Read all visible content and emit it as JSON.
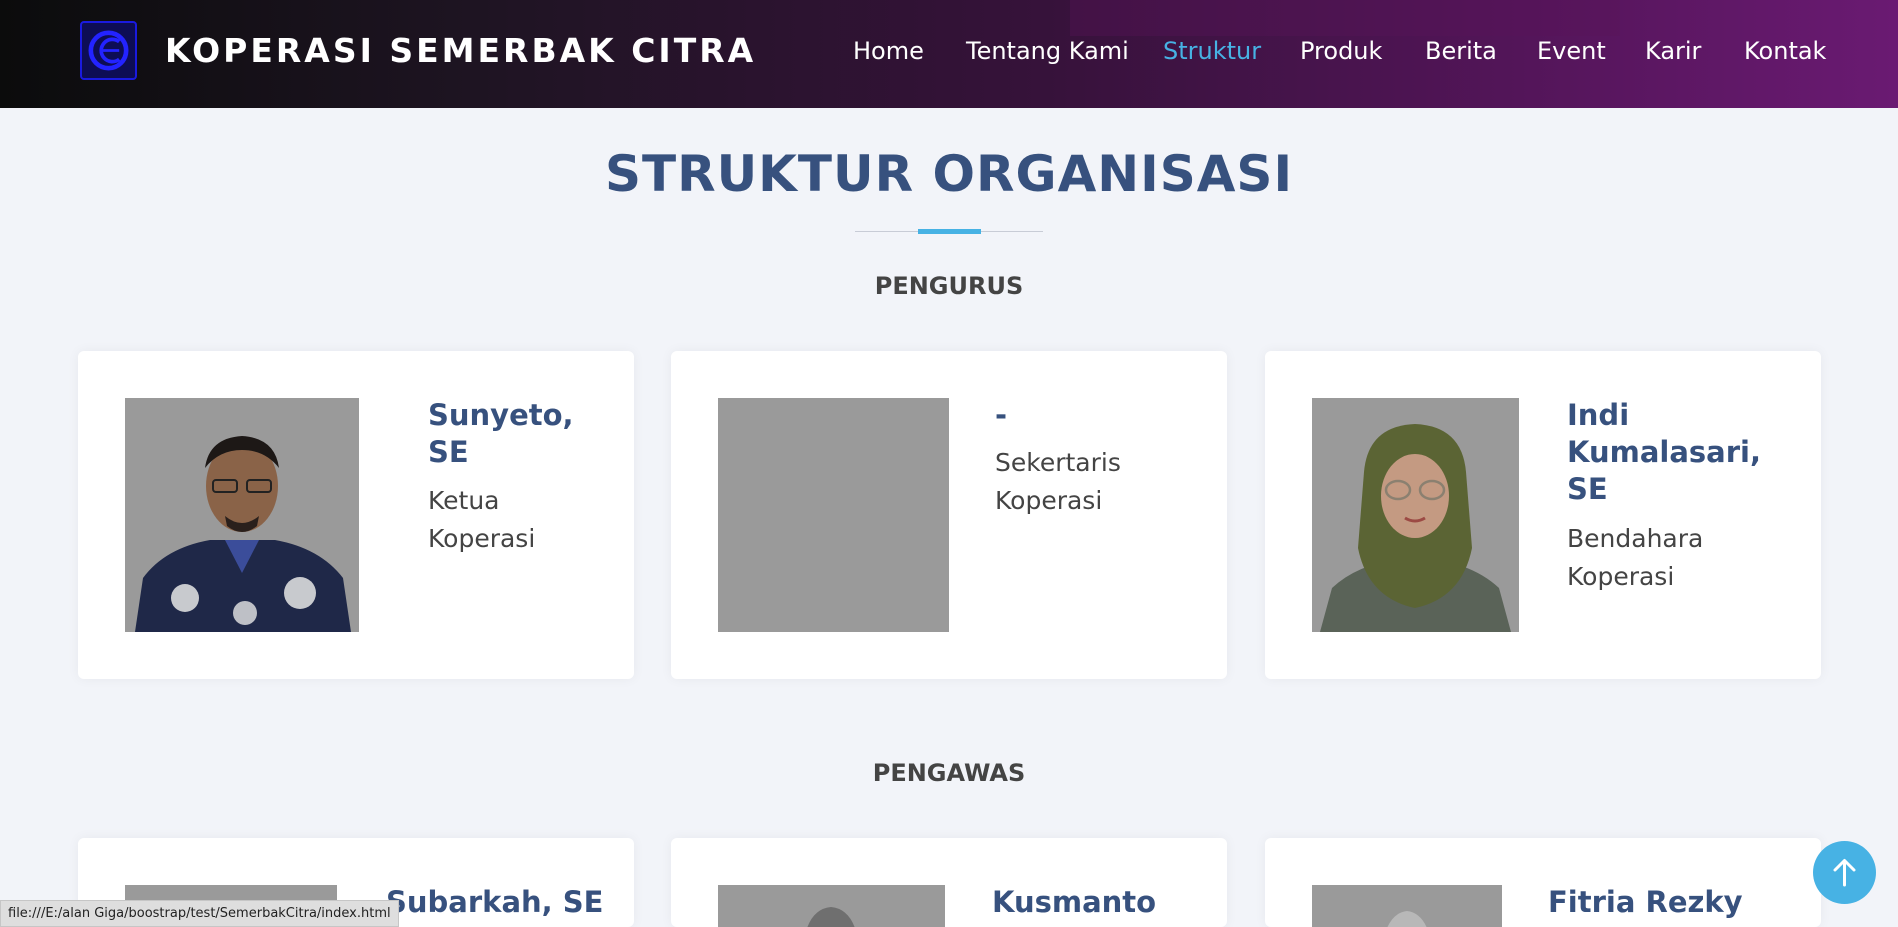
{
  "brand": {
    "name": "KOPERASI SEMERBAK CITRA",
    "logo_icon": "cs-logo-icon"
  },
  "nav": [
    {
      "label": "Home",
      "active": false
    },
    {
      "label": "Tentang Kami",
      "active": false
    },
    {
      "label": "Struktur",
      "active": true
    },
    {
      "label": "Produk",
      "active": false
    },
    {
      "label": "Berita",
      "active": false
    },
    {
      "label": "Event",
      "active": false
    },
    {
      "label": "Karir",
      "active": false
    },
    {
      "label": "Kontak",
      "active": false
    }
  ],
  "page_title": "STRUKTUR ORGANISASI",
  "sections": {
    "pengurus": {
      "title": "PENGURUS",
      "members": [
        {
          "name": "Sunyeto,\nSE",
          "role": "Ketua\nKoperasi"
        },
        {
          "name": "-",
          "role": "Sekertaris\nKoperasi"
        },
        {
          "name": "Indi\nKumalasari,\nSE",
          "role": "Bendahara\nKoperasi"
        }
      ]
    },
    "pengawas": {
      "title": "PENGAWAS",
      "members": [
        {
          "name": "Subarkah, SE"
        },
        {
          "name": "Kusmanto"
        },
        {
          "name": "Fitria Rezky"
        }
      ]
    }
  },
  "status_bar": "file:///E:/alan Giga/boostrap/test/SemerbakCitra/index.html",
  "back_to_top_icon": "arrow-up-icon",
  "colors": {
    "accent": "#47b2e4",
    "heading": "#37517e",
    "background": "#f2f4f9"
  }
}
